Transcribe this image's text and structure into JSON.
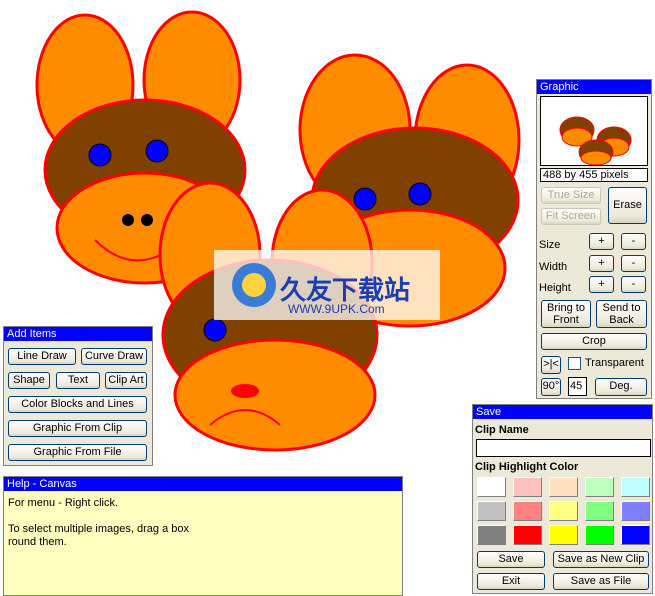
{
  "watermark": {
    "text": "久友下载站",
    "url": "WWW.9UPK.Com"
  },
  "add_items": {
    "title": "Add Items",
    "buttons": [
      "Line Draw",
      "Curve Draw",
      "Shape",
      "Text",
      "Clip Art",
      "Color Blocks and Lines",
      "Graphic From Clip",
      "Graphic From File"
    ]
  },
  "help": {
    "title": "Help -    Canvas",
    "line1": "For menu - Right click.",
    "line2": "To select multiple images, drag a box",
    "line3": "round them."
  },
  "graphic": {
    "title": "Graphic",
    "size_text": "488 by 455 pixels",
    "true_size": "True Size",
    "fit_screen": "Fit Screen",
    "erase": "Erase",
    "size_label": "Size",
    "width_label": "Width",
    "height_label": "Height",
    "plus": "+",
    "minus": "-",
    "bring_front": "Bring to Front",
    "send_back": "Send to Back",
    "crop": "Crop",
    "flip": ">|<",
    "transparent": "Transparent",
    "transparent_checked": false,
    "rotate": "90°",
    "degrees_value": "45",
    "deg": "Deg."
  },
  "save": {
    "title": "Save",
    "clip_name_label": "Clip Name",
    "clip_name_value": "",
    "highlight_label": "Clip Highlight Color",
    "colors": [
      "#ffffff",
      "#ffc0c0",
      "#ffe0c0",
      "#c0ffc0",
      "#c0ffff",
      "#c0c0c0",
      "#ff8080",
      "#ffff80",
      "#80ff80",
      "#8080ff",
      "#808080",
      "#ff0000",
      "#ffff00",
      "#00ff00",
      "#0000ff"
    ],
    "save": "Save",
    "save_new": "Save as New Clip",
    "exit": "Exit",
    "save_file": "Save as File"
  },
  "colors": {
    "ear": "#ff8c00",
    "face": "#804000",
    "outline": "#ff0000",
    "eye": "#0000ff",
    "title_bar": "#0000ff",
    "help_bg": "#ffffc0"
  }
}
